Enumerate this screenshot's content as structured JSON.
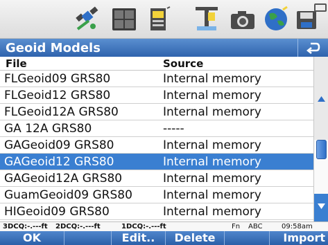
{
  "toolbar": {
    "icons": [
      "satellite-icon",
      "survey-grid-icon",
      "data-panel-icon",
      "antenna-icon",
      "camera-icon",
      "globe-icon",
      "save-icon",
      "battery-icon"
    ]
  },
  "window": {
    "title": "Geoid Models"
  },
  "table": {
    "columns": {
      "file": "File",
      "source": "Source"
    },
    "rows": [
      {
        "file": "FLGeoid09 GRS80",
        "source": "Internal memory"
      },
      {
        "file": "FLGeoid12 GRS80",
        "source": "Internal memory"
      },
      {
        "file": "FLGeoid12A GRS80",
        "source": "Internal memory"
      },
      {
        "file": "GA 12A GRS80",
        "source": "-----"
      },
      {
        "file": "GAGeoid09 GRS80",
        "source": "Internal memory"
      },
      {
        "file": "GAGeoid12 GRS80",
        "source": "Internal memory"
      },
      {
        "file": "GAGeoid12A GRS80",
        "source": "Internal memory"
      },
      {
        "file": "GuamGeoid09 GRS80",
        "source": "Internal memory"
      },
      {
        "file": "HIGeoid09 GRS80",
        "source": "Internal memory"
      }
    ],
    "selected_row": "GAGeoid12 GRS80"
  },
  "status_bar": {
    "dcq3": "3DCQ:-.---ft",
    "dcq2": "2DCQ:-.---ft",
    "dcq1": "1DCQ:-.---ft",
    "fn": "Fn",
    "input_mode": "ABC",
    "time": "09:58am"
  },
  "softkeys": {
    "ok": "OK",
    "edit": "Edit..",
    "delete": "Delete",
    "import": "Import"
  },
  "colors": {
    "title_bar": "#3a72bf",
    "selection": "#3a7fd1",
    "softkey_bar": "#3b70b9"
  }
}
